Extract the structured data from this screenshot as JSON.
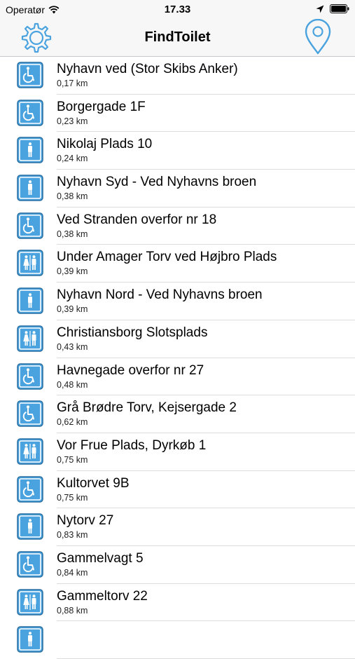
{
  "status_bar": {
    "carrier": "Operatør",
    "time": "17.33"
  },
  "nav": {
    "title": "FindToilet",
    "accent": "#4aa3df"
  },
  "toilets": [
    {
      "name": "Nyhavn ved (Stor Skibs Anker)",
      "distance": "0,17 km",
      "icon": "wheelchair-icon"
    },
    {
      "name": "Borgergade 1F",
      "distance": "0,23 km",
      "icon": "wheelchair-icon"
    },
    {
      "name": "Nikolaj Plads 10",
      "distance": "0,24 km",
      "icon": "man-icon"
    },
    {
      "name": "Nyhavn Syd - Ved Nyhavns broen",
      "distance": "0,38 km",
      "icon": "man-icon"
    },
    {
      "name": "Ved Stranden overfor nr 18",
      "distance": "0,38 km",
      "icon": "wheelchair-icon"
    },
    {
      "name": "Under Amager Torv ved Højbro Plads",
      "distance": "0,39 km",
      "icon": "woman-man-icon"
    },
    {
      "name": "Nyhavn Nord - Ved Nyhavns broen",
      "distance": "0,39 km",
      "icon": "man-icon"
    },
    {
      "name": "Christiansborg Slotsplads",
      "distance": "0,43 km",
      "icon": "woman-man-icon"
    },
    {
      "name": "Havnegade overfor nr 27",
      "distance": "0,48 km",
      "icon": "wheelchair-icon"
    },
    {
      "name": "Grå Brødre Torv, Kejsergade 2",
      "distance": "0,62 km",
      "icon": "wheelchair-icon"
    },
    {
      "name": "Vor Frue Plads, Dyrkøb 1",
      "distance": "0,75 km",
      "icon": "woman-man-icon"
    },
    {
      "name": "Kultorvet 9B",
      "distance": "0,75 km",
      "icon": "wheelchair-icon"
    },
    {
      "name": "Nytorv 27",
      "distance": "0,83 km",
      "icon": "man-icon"
    },
    {
      "name": "Gammelvagt 5",
      "distance": "0,84 km",
      "icon": "wheelchair-icon"
    },
    {
      "name": "Gammeltorv 22",
      "distance": "0,88 km",
      "icon": "woman-man-icon"
    },
    {
      "name": "",
      "distance": "",
      "icon": "man-icon"
    }
  ]
}
